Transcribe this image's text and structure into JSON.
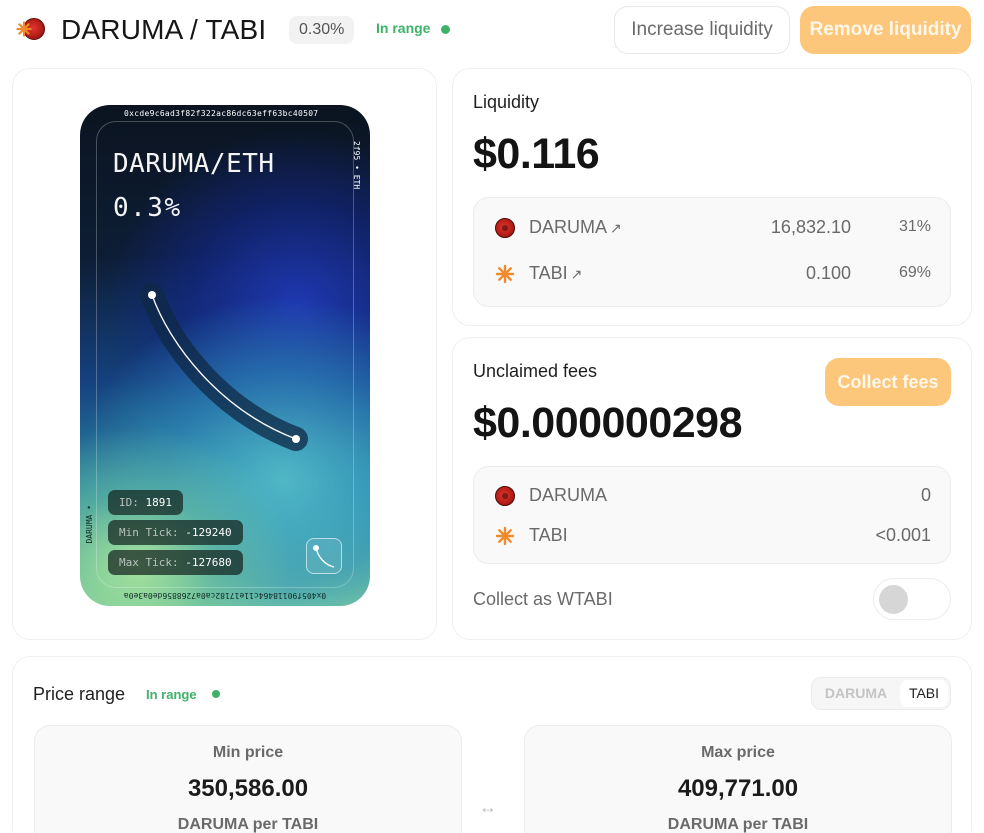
{
  "header": {
    "title": "DARUMA / TABI",
    "fee_tier": "0.30%",
    "range_status": "In range",
    "increase_label": "Increase liquidity",
    "remove_label": "Remove liquidity"
  },
  "nft": {
    "pair": "DARUMA/ETH",
    "fee": "0.3%",
    "top_address": "0xcde9c6ad3f82f322ac86dc63eff63bc40507",
    "right_label": "2f95 • ETH",
    "bottom_address": "0x405f90118464c11e17182ca0a7268856de0a3e0a",
    "left_label": "DARUMA •",
    "id_key": "ID:",
    "id_value": "1891",
    "min_tick_key": "Min Tick:",
    "min_tick_value": "-129240",
    "max_tick_key": "Max Tick:",
    "max_tick_value": "-127680"
  },
  "liquidity": {
    "label": "Liquidity",
    "value": "$0.116",
    "tokens": [
      {
        "name": "DARUMA",
        "arrow": "↗",
        "amount": "16,832.10",
        "pct": "31%"
      },
      {
        "name": "TABI",
        "arrow": "↗",
        "amount": "0.100",
        "pct": "69%"
      }
    ]
  },
  "fees": {
    "label": "Unclaimed fees",
    "value": "$0.000000298",
    "collect_label": "Collect fees",
    "tokens": [
      {
        "name": "DARUMA",
        "amount": "0"
      },
      {
        "name": "TABI",
        "amount": "<0.001"
      }
    ],
    "collect_as_label": "Collect as WTABI"
  },
  "price_range": {
    "title": "Price range",
    "status": "In range",
    "toggle_a": "DARUMA",
    "toggle_b": "TABI",
    "min": {
      "label": "Min price",
      "value": "350,586.00",
      "unit": "DARUMA per TABI"
    },
    "max": {
      "label": "Max price",
      "value": "409,771.00",
      "unit": "DARUMA per TABI"
    },
    "swap_symbol": "↔"
  },
  "colors": {
    "accent": "#fdc77b",
    "in_range": "#3fb26a",
    "daruma_token": "#c0201a",
    "tabi_token": "#f08a2c"
  },
  "icons": {
    "daruma": "daruma-token-icon",
    "tabi": "tabi-token-icon"
  }
}
